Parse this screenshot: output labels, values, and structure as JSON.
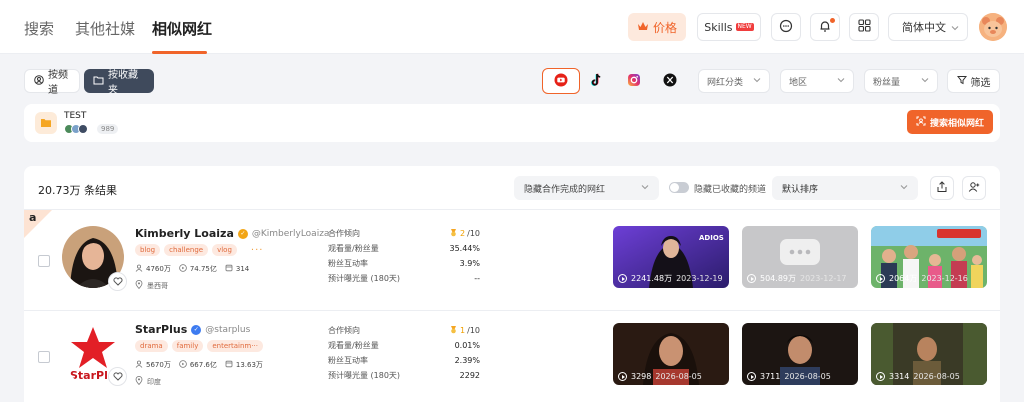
{
  "nav": {
    "tabs": [
      "搜索",
      "其他社媒",
      "相似网红"
    ],
    "price_label": "价格",
    "skills_label": "Skills",
    "new_badge": "NEW",
    "language": "简体中文"
  },
  "filters": {
    "by_channel": "按频道",
    "by_folder": "按收藏夹",
    "platforms": [
      "youtube-icon",
      "tiktok-icon",
      "instagram-icon",
      "x-icon"
    ],
    "category": "网红分类",
    "region": "地区",
    "followers": "粉丝量",
    "filter_btn": "筛选"
  },
  "collection": {
    "name": "TEST",
    "count": "989",
    "search_similar": "搜索相似网红"
  },
  "results": {
    "count_text": "20.73万 条结果",
    "hide_done": "隐藏合作完成的网红",
    "hide_saved": "隐藏已收藏的频道",
    "sort": "默认排序"
  },
  "metric_labels": {
    "trend": "合作倾向",
    "view_follower": "观看量/粉丝量",
    "engagement": "粉丝互动率",
    "exposure": "预计曝光量 (180天)"
  },
  "accent_color": "#f0642a",
  "influencers": [
    {
      "rank": "a",
      "name": "Kimberly Loaiza",
      "handle": "@KimberlyLoaiza",
      "badge_color": "#f2a516",
      "tags": [
        "blog",
        "challenge",
        "vlog"
      ],
      "followers": "4760万",
      "views": "74.75亿",
      "videos": "314",
      "location": "墨西哥",
      "trend_score": "2",
      "trend_max": "/10",
      "view_follower": "35.44%",
      "engagement": "3.9%",
      "exposure": "--",
      "thumbs": [
        {
          "views": "2241.48万",
          "date": "2023-12-19"
        },
        {
          "views": "504.89万",
          "date": "2023-12-17"
        },
        {
          "views": "2064万",
          "date": "2023-12-16"
        }
      ]
    },
    {
      "name": "StarPlus",
      "handle": "@starplus",
      "badge_color": "#3d7bf0",
      "tags": [
        "drama",
        "family",
        "entertainm···"
      ],
      "followers": "5670万",
      "views": "667.6亿",
      "videos": "13.63万",
      "location": "印度",
      "trend_score": "1",
      "trend_max": "/10",
      "view_follower": "0.01%",
      "engagement": "2.39%",
      "exposure": "2292",
      "thumbs": [
        {
          "views": "3298",
          "date": "2026-08-05"
        },
        {
          "views": "3711",
          "date": "2026-08-05"
        },
        {
          "views": "3314",
          "date": "2026-08-05"
        }
      ]
    }
  ]
}
